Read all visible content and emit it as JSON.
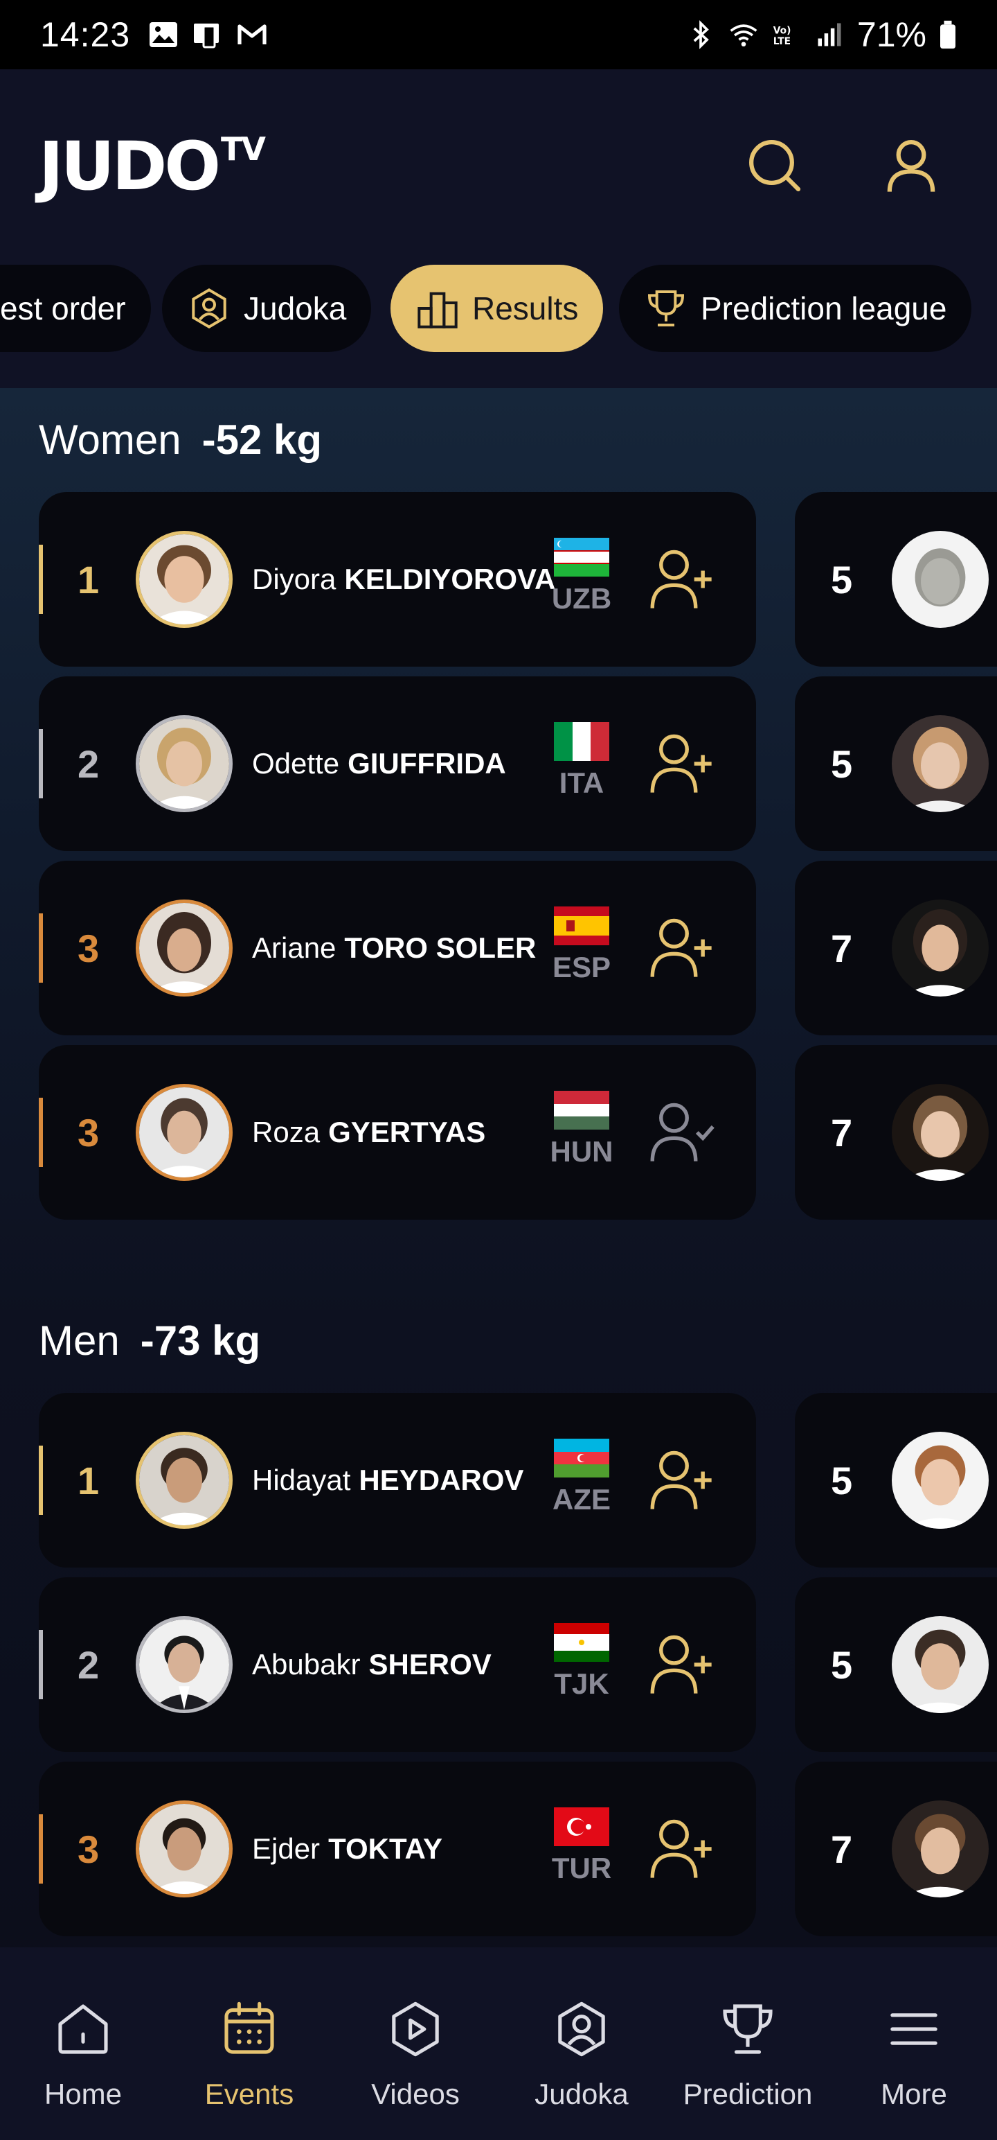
{
  "status_bar": {
    "time": "14:23",
    "battery": "71%"
  },
  "header": {
    "logo_main": "JUDO",
    "logo_sup": "TV"
  },
  "tabs": [
    {
      "label": "est order",
      "active": false
    },
    {
      "label": "Judoka",
      "active": false
    },
    {
      "label": "Results",
      "active": true
    },
    {
      "label": "Prediction league",
      "active": false
    }
  ],
  "sections": [
    {
      "gender": "Women",
      "weight": "-52 kg",
      "results": [
        {
          "rank": "1",
          "first": "Diyora",
          "last": "KELDIYOROVA",
          "code": "UZB",
          "followed": false,
          "side_num": "5"
        },
        {
          "rank": "2",
          "first": "Odette",
          "last": "GIUFFRIDA",
          "code": "ITA",
          "followed": false,
          "side_num": "5"
        },
        {
          "rank": "3",
          "first": "Ariane",
          "last": "TORO SOLER",
          "code": "ESP",
          "followed": false,
          "side_num": "7"
        },
        {
          "rank": "3",
          "first": "Roza",
          "last": "GYERTYAS",
          "code": "HUN",
          "followed": true,
          "side_num": "7"
        }
      ]
    },
    {
      "gender": "Men",
      "weight": "-73 kg",
      "results": [
        {
          "rank": "1",
          "first": "Hidayat",
          "last": "HEYDAROV",
          "code": "AZE",
          "followed": false,
          "side_num": "5"
        },
        {
          "rank": "2",
          "first": "Abubakr",
          "last": "SHEROV",
          "code": "TJK",
          "followed": false,
          "side_num": "5"
        },
        {
          "rank": "3",
          "first": "Ejder",
          "last": "TOKTAY",
          "code": "TUR",
          "followed": false,
          "side_num": "7"
        }
      ]
    }
  ],
  "colors": {
    "gold": "#e6c370",
    "silver": "#b9b9bf",
    "bronze": "#d98a3c",
    "background": "#0b0c16"
  },
  "bottom_nav": [
    {
      "label": "Home",
      "icon": "home-icon",
      "active": false
    },
    {
      "label": "Events",
      "icon": "calendar-icon",
      "active": true
    },
    {
      "label": "Videos",
      "icon": "play-icon",
      "active": false
    },
    {
      "label": "Judoka",
      "icon": "judoka-icon",
      "active": false
    },
    {
      "label": "Prediction",
      "icon": "trophy-icon",
      "active": false
    },
    {
      "label": "More",
      "icon": "menu-icon",
      "active": false
    }
  ]
}
